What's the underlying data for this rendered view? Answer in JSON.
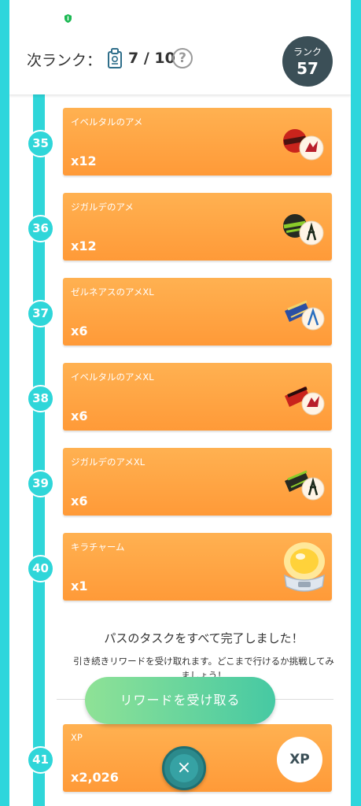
{
  "colors": {
    "accent": "#2fd6d9",
    "card": "#ff9a38",
    "rank_bg": "#3b4f57",
    "claim": "#46c9a3"
  },
  "header": {
    "next_rank_label": "次ランク：",
    "progress": "7 / 10",
    "help_icon": "?",
    "rank_label": "ランク",
    "rank_value": "57"
  },
  "rewards": [
    {
      "level": "35",
      "title": "イベルタルのアメ",
      "qty": "x12",
      "icon": "yveltal-candy-icon"
    },
    {
      "level": "36",
      "title": "ジガルデのアメ",
      "qty": "x12",
      "icon": "zygarde-candy-icon"
    },
    {
      "level": "37",
      "title": "ゼルネアスのアメXL",
      "qty": "x6",
      "icon": "xerneas-candy-xl-icon"
    },
    {
      "level": "38",
      "title": "イベルタルのアメXL",
      "qty": "x6",
      "icon": "yveltal-candy-xl-icon"
    },
    {
      "level": "39",
      "title": "ジガルデのアメXL",
      "qty": "x6",
      "icon": "zygarde-candy-xl-icon"
    },
    {
      "level": "40",
      "title": "キラチャーム",
      "qty": "x1",
      "icon": "lucky-charm-icon"
    },
    {
      "level": "41",
      "title": "XP",
      "qty": "x2,026",
      "icon": "xp-icon",
      "badge": "XP"
    }
  ],
  "completion": {
    "title": "パスのタスクをすべて完了しました！",
    "subtitle": "引き続きリワードを受け取れます。どこまで行けるか挑戦してみましょう！"
  },
  "claim_button": "リワードを受け取る",
  "close_label": "×"
}
